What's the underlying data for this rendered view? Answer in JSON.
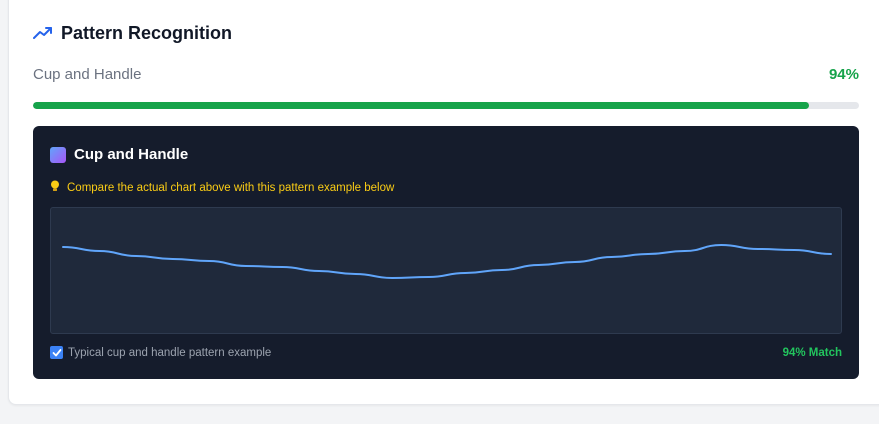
{
  "header": {
    "title": "Pattern Recognition",
    "icon": "trending-up-icon",
    "icon_color": "#2563eb"
  },
  "pattern": {
    "name": "Cup and Handle",
    "percent_label": "94%",
    "progress_fraction": 0.94,
    "accent": "#16a34a"
  },
  "panel": {
    "title": "Cup and Handle",
    "title_icon": "gradient-square-icon",
    "hint_icon": "lightbulb-icon",
    "hint": "Compare the actual chart above with this pattern example below",
    "caption": "Typical cup and handle pattern example",
    "caption_checked": true,
    "match_label": "94% Match",
    "line_color": "#60a5fa"
  },
  "chart_data": {
    "type": "line",
    "series": [
      {
        "values": [
          88,
          84,
          79,
          76,
          74,
          69,
          68,
          64,
          61,
          57,
          58,
          62,
          65,
          70,
          73,
          78,
          81,
          84,
          90,
          86,
          85,
          81
        ]
      }
    ]
  }
}
